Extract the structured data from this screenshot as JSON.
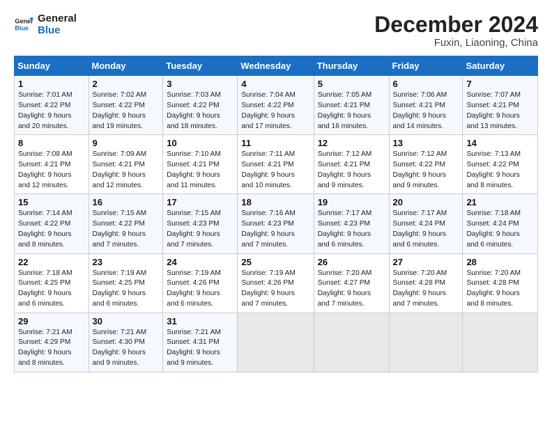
{
  "logo": {
    "line1": "General",
    "line2": "Blue"
  },
  "title": "December 2024",
  "subtitle": "Fuxin, Liaoning, China",
  "days_of_week": [
    "Sunday",
    "Monday",
    "Tuesday",
    "Wednesday",
    "Thursday",
    "Friday",
    "Saturday"
  ],
  "weeks": [
    [
      {
        "day": "1",
        "detail": "Sunrise: 7:01 AM\nSunset: 4:22 PM\nDaylight: 9 hours\nand 20 minutes."
      },
      {
        "day": "2",
        "detail": "Sunrise: 7:02 AM\nSunset: 4:22 PM\nDaylight: 9 hours\nand 19 minutes."
      },
      {
        "day": "3",
        "detail": "Sunrise: 7:03 AM\nSunset: 4:22 PM\nDaylight: 9 hours\nand 18 minutes."
      },
      {
        "day": "4",
        "detail": "Sunrise: 7:04 AM\nSunset: 4:22 PM\nDaylight: 9 hours\nand 17 minutes."
      },
      {
        "day": "5",
        "detail": "Sunrise: 7:05 AM\nSunset: 4:21 PM\nDaylight: 9 hours\nand 16 minutes."
      },
      {
        "day": "6",
        "detail": "Sunrise: 7:06 AM\nSunset: 4:21 PM\nDaylight: 9 hours\nand 14 minutes."
      },
      {
        "day": "7",
        "detail": "Sunrise: 7:07 AM\nSunset: 4:21 PM\nDaylight: 9 hours\nand 13 minutes."
      }
    ],
    [
      {
        "day": "8",
        "detail": "Sunrise: 7:08 AM\nSunset: 4:21 PM\nDaylight: 9 hours\nand 12 minutes."
      },
      {
        "day": "9",
        "detail": "Sunrise: 7:09 AM\nSunset: 4:21 PM\nDaylight: 9 hours\nand 12 minutes."
      },
      {
        "day": "10",
        "detail": "Sunrise: 7:10 AM\nSunset: 4:21 PM\nDaylight: 9 hours\nand 11 minutes."
      },
      {
        "day": "11",
        "detail": "Sunrise: 7:11 AM\nSunset: 4:21 PM\nDaylight: 9 hours\nand 10 minutes."
      },
      {
        "day": "12",
        "detail": "Sunrise: 7:12 AM\nSunset: 4:21 PM\nDaylight: 9 hours\nand 9 minutes."
      },
      {
        "day": "13",
        "detail": "Sunrise: 7:12 AM\nSunset: 4:22 PM\nDaylight: 9 hours\nand 9 minutes."
      },
      {
        "day": "14",
        "detail": "Sunrise: 7:13 AM\nSunset: 4:22 PM\nDaylight: 9 hours\nand 8 minutes."
      }
    ],
    [
      {
        "day": "15",
        "detail": "Sunrise: 7:14 AM\nSunset: 4:22 PM\nDaylight: 9 hours\nand 8 minutes."
      },
      {
        "day": "16",
        "detail": "Sunrise: 7:15 AM\nSunset: 4:22 PM\nDaylight: 9 hours\nand 7 minutes."
      },
      {
        "day": "17",
        "detail": "Sunrise: 7:15 AM\nSunset: 4:23 PM\nDaylight: 9 hours\nand 7 minutes."
      },
      {
        "day": "18",
        "detail": "Sunrise: 7:16 AM\nSunset: 4:23 PM\nDaylight: 9 hours\nand 7 minutes."
      },
      {
        "day": "19",
        "detail": "Sunrise: 7:17 AM\nSunset: 4:23 PM\nDaylight: 9 hours\nand 6 minutes."
      },
      {
        "day": "20",
        "detail": "Sunrise: 7:17 AM\nSunset: 4:24 PM\nDaylight: 9 hours\nand 6 minutes."
      },
      {
        "day": "21",
        "detail": "Sunrise: 7:18 AM\nSunset: 4:24 PM\nDaylight: 9 hours\nand 6 minutes."
      }
    ],
    [
      {
        "day": "22",
        "detail": "Sunrise: 7:18 AM\nSunset: 4:25 PM\nDaylight: 9 hours\nand 6 minutes."
      },
      {
        "day": "23",
        "detail": "Sunrise: 7:19 AM\nSunset: 4:25 PM\nDaylight: 9 hours\nand 6 minutes."
      },
      {
        "day": "24",
        "detail": "Sunrise: 7:19 AM\nSunset: 4:26 PM\nDaylight: 9 hours\nand 6 minutes."
      },
      {
        "day": "25",
        "detail": "Sunrise: 7:19 AM\nSunset: 4:26 PM\nDaylight: 9 hours\nand 7 minutes."
      },
      {
        "day": "26",
        "detail": "Sunrise: 7:20 AM\nSunset: 4:27 PM\nDaylight: 9 hours\nand 7 minutes."
      },
      {
        "day": "27",
        "detail": "Sunrise: 7:20 AM\nSunset: 4:28 PM\nDaylight: 9 hours\nand 7 minutes."
      },
      {
        "day": "28",
        "detail": "Sunrise: 7:20 AM\nSunset: 4:28 PM\nDaylight: 9 hours\nand 8 minutes."
      }
    ],
    [
      {
        "day": "29",
        "detail": "Sunrise: 7:21 AM\nSunset: 4:29 PM\nDaylight: 9 hours\nand 8 minutes."
      },
      {
        "day": "30",
        "detail": "Sunrise: 7:21 AM\nSunset: 4:30 PM\nDaylight: 9 hours\nand 9 minutes."
      },
      {
        "day": "31",
        "detail": "Sunrise: 7:21 AM\nSunset: 4:31 PM\nDaylight: 9 hours\nand 9 minutes."
      },
      {
        "day": "",
        "detail": ""
      },
      {
        "day": "",
        "detail": ""
      },
      {
        "day": "",
        "detail": ""
      },
      {
        "day": "",
        "detail": ""
      }
    ]
  ]
}
